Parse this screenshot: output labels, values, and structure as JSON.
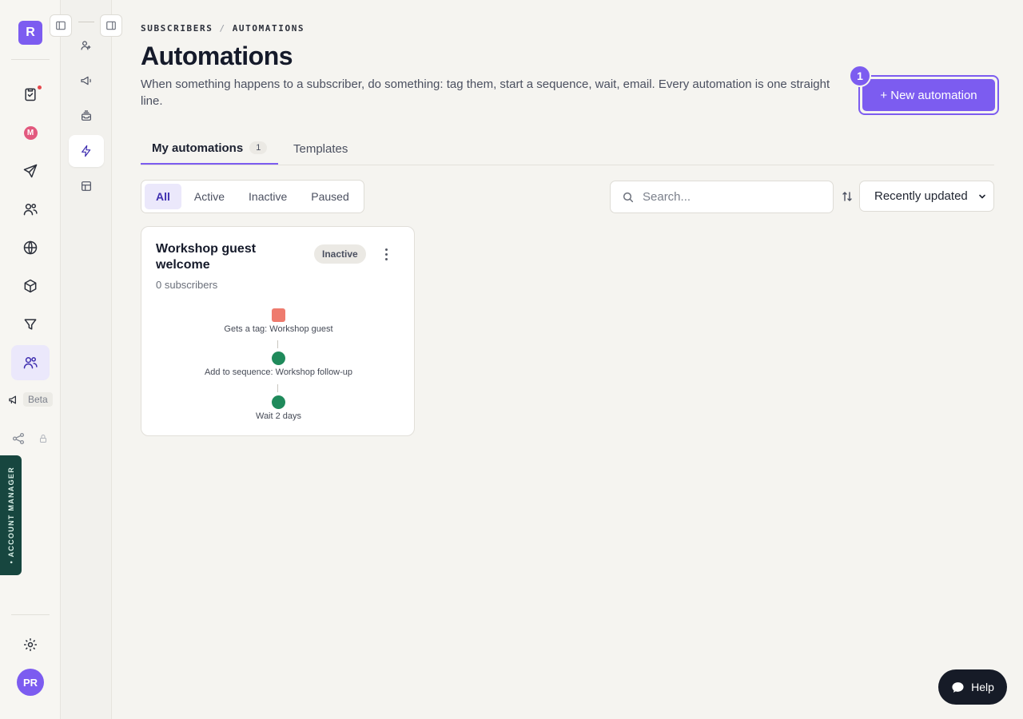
{
  "brand": {
    "letter": "R"
  },
  "rail": {
    "beta_label": "Beta",
    "account_manager_label": "• ACCOUNT MANAGER",
    "avatar_initials": "PR",
    "accent_color": "#7c5cf0"
  },
  "breadcrumb": {
    "parent": "SUBSCRIBERS",
    "separator": "/",
    "current": "AUTOMATIONS"
  },
  "header": {
    "title": "Automations",
    "subtitle": "When something happens to a subscriber, do something: tag them, start a sequence, wait, email. Every automation is one straight line.",
    "new_button_label": "+ New automation",
    "step_badge": "1"
  },
  "tabs": [
    {
      "label": "My automations",
      "count": "1"
    },
    {
      "label": "Templates"
    }
  ],
  "filters": [
    "All",
    "Active",
    "Inactive",
    "Paused"
  ],
  "search": {
    "placeholder": "Search..."
  },
  "sort": {
    "selected": "Recently updated"
  },
  "automations": [
    {
      "title": "Workshop guest welcome",
      "subscribers": "0 subscribers",
      "status": "Inactive",
      "steps": [
        {
          "label": "Gets a tag: Workshop guest",
          "kind": "trigger",
          "color": "#ee7b6e"
        },
        {
          "label": "Add to sequence: Workshop follow-up",
          "kind": "action",
          "color": "#1f8a5b"
        },
        {
          "label": "Wait 2 days",
          "kind": "action",
          "color": "#1f8a5b"
        }
      ]
    }
  ],
  "help": {
    "label": "Help"
  }
}
